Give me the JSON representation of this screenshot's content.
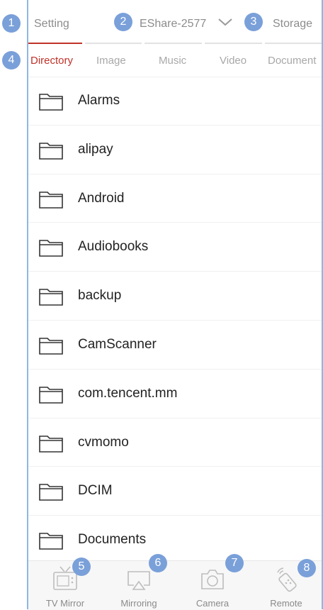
{
  "header": {
    "setting": "Setting",
    "device": "EShare-2577",
    "storage": "Storage"
  },
  "tabs": [
    "Directory",
    "Image",
    "Music",
    "Video",
    "Document"
  ],
  "active_tab": "Directory",
  "folders": [
    "Alarms",
    "alipay",
    "Android",
    "Audiobooks",
    "backup",
    "CamScanner",
    "com.tencent.mm",
    "cvmomo",
    "DCIM",
    "Documents"
  ],
  "bottom_nav": [
    {
      "label": "TV Mirror",
      "icon": "tv-icon"
    },
    {
      "label": "Mirroring",
      "icon": "mirroring-icon"
    },
    {
      "label": "Camera",
      "icon": "camera-icon"
    },
    {
      "label": "Remote",
      "icon": "remote-icon"
    }
  ],
  "badges": [
    "1",
    "2",
    "3",
    "4",
    "5",
    "6",
    "7",
    "8"
  ],
  "colors": {
    "accent": "#c0322a",
    "badge": "#7aa0d9",
    "frame": "#8fb6e3"
  }
}
